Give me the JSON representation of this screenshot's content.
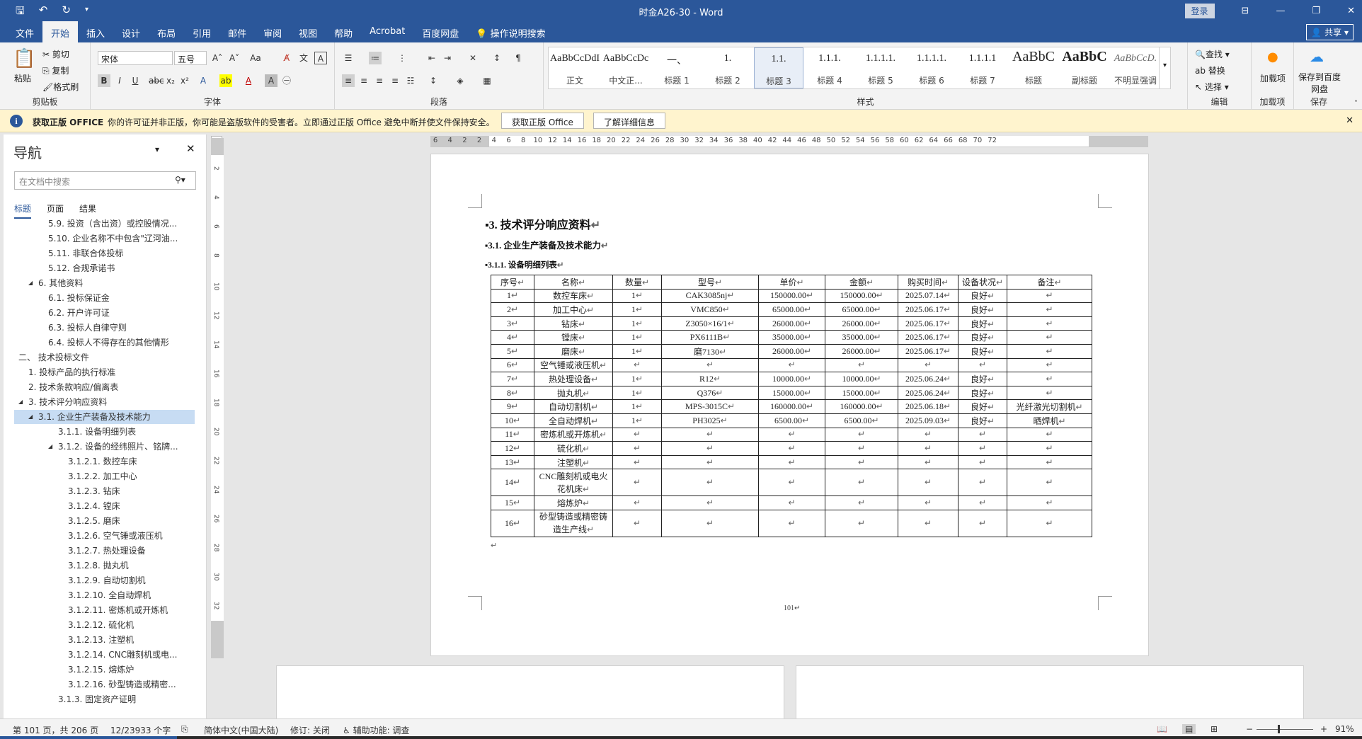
{
  "window": {
    "title": "时金A26-30  -  Word",
    "login": "登录",
    "share": "共享"
  },
  "tabs": [
    "文件",
    "开始",
    "插入",
    "设计",
    "布局",
    "引用",
    "邮件",
    "审阅",
    "视图",
    "帮助",
    "Acrobat",
    "百度网盘",
    "操作说明搜索"
  ],
  "ribbon": {
    "clipboard": {
      "paste": "粘贴",
      "cut": "剪切",
      "copy": "复制",
      "format_painter": "格式刷",
      "label": "剪贴板"
    },
    "font": {
      "name": "宋体",
      "size": "五号",
      "label": "字体"
    },
    "paragraph": {
      "label": "段落"
    },
    "styles": {
      "label": "样式",
      "items": [
        {
          "sample": "AaBbCcDdI",
          "name": "正文"
        },
        {
          "sample": "AaBbCcDc",
          "name": "中文正..."
        },
        {
          "sample": "一、",
          "name": "标题 1"
        },
        {
          "sample": "1.",
          "name": "标题 2"
        },
        {
          "sample": "1.1.",
          "name": "标题 3"
        },
        {
          "sample": "1.1.1.",
          "name": "标题 4"
        },
        {
          "sample": "1.1.1.1.",
          "name": "标题 5"
        },
        {
          "sample": "1.1.1.1.",
          "name": "标题 6"
        },
        {
          "sample": "1.1.1.1",
          "name": "标题 7"
        },
        {
          "sample": "AaBbC",
          "name": "标题"
        },
        {
          "sample": "AaBbC",
          "name": "副标题"
        },
        {
          "sample": "AaBbCcD.",
          "name": "不明显强调"
        }
      ]
    },
    "editing": {
      "find": "查找",
      "replace": "替换",
      "select": "选择",
      "label": "编辑"
    },
    "addins": {
      "btn": "加载项",
      "label": "加载项"
    },
    "save": {
      "btn": "保存到百度网盘",
      "label": "保存"
    }
  },
  "message_bar": {
    "title": "获取正版 OFFICE",
    "text": "你的许可证并非正版，你可能是盗版软件的受害者。立即通过正版 Office 避免中断并使文件保持安全。",
    "btn_get": "获取正版 Office",
    "btn_learn": "了解详细信息"
  },
  "nav": {
    "title": "导航",
    "search_placeholder": "在文档中搜索",
    "tabs": [
      "标题",
      "页面",
      "结果"
    ],
    "items": [
      {
        "text": "5.9. 投资（含出资）或控股情况...",
        "level": 4
      },
      {
        "text": "5.10. 企业名称不中包含\"辽河油...",
        "level": 4
      },
      {
        "text": "5.11. 非联合体投标",
        "level": 4
      },
      {
        "text": "5.12. 合规承诺书",
        "level": 4
      },
      {
        "text": "6. 其他资料",
        "level": 3,
        "arrow": "◢"
      },
      {
        "text": "6.1. 投标保证金",
        "level": 4
      },
      {
        "text": "6.2. 开户许可证",
        "level": 4
      },
      {
        "text": "6.3. 投标人自律守则",
        "level": 4
      },
      {
        "text": "6.4. 投标人不得存在的其他情形",
        "level": 4
      },
      {
        "text": "二、 技术投标文件",
        "level": 1,
        "arrow": "◢"
      },
      {
        "text": "1. 投标产品的执行标准",
        "level": 2
      },
      {
        "text": "2. 技术条款响应/偏离表",
        "level": 2
      },
      {
        "text": "3. 技术评分响应资料",
        "level": 2,
        "arrow": "◢"
      },
      {
        "text": "3.1. 企业生产装备及技术能力",
        "level": 3,
        "arrow": "◢",
        "selected": true
      },
      {
        "text": "3.1.1. 设备明细列表",
        "level": 5
      },
      {
        "text": "3.1.2. 设备的经纬照片、铭牌...",
        "level": 5,
        "arrow": "◢"
      },
      {
        "text": "3.1.2.1. 数控车床",
        "level": 6
      },
      {
        "text": "3.1.2.2. 加工中心",
        "level": 6
      },
      {
        "text": "3.1.2.3. 钻床",
        "level": 6
      },
      {
        "text": "3.1.2.4. 镗床",
        "level": 6
      },
      {
        "text": "3.1.2.5. 磨床",
        "level": 6
      },
      {
        "text": "3.1.2.6. 空气锤或液压机",
        "level": 6
      },
      {
        "text": "3.1.2.7. 热处理设备",
        "level": 6
      },
      {
        "text": "3.1.2.8. 抛丸机",
        "level": 6
      },
      {
        "text": "3.1.2.9. 自动切割机",
        "level": 6
      },
      {
        "text": "3.1.2.10. 全自动焊机",
        "level": 6
      },
      {
        "text": "3.1.2.11. 密炼机或开炼机",
        "level": 6
      },
      {
        "text": "3.1.2.12. 硫化机",
        "level": 6
      },
      {
        "text": "3.1.2.13. 注塑机",
        "level": 6
      },
      {
        "text": "3.1.2.14. CNC雕刻机或电...",
        "level": 6
      },
      {
        "text": "3.1.2.15. 熔炼炉",
        "level": 6
      },
      {
        "text": "3.1.2.16. 砂型铸造或精密...",
        "level": 6
      },
      {
        "text": "3.1.3. 固定资产证明",
        "level": 5
      }
    ]
  },
  "document": {
    "h1": "3. 技术评分响应资料",
    "h2": "3.1. 企业生产装备及技术能力",
    "h3": "3.1.1. 设备明细列表",
    "table": {
      "headers": [
        "序号",
        "名称",
        "数量",
        "型号",
        "单价",
        "金额",
        "购买时间",
        "设备状况",
        "备注"
      ],
      "rows": [
        [
          "1",
          "数控车床",
          "1",
          "CAK3085nj",
          "150000.00",
          "150000.00",
          "2025.07.14",
          "良好",
          ""
        ],
        [
          "2",
          "加工中心",
          "1",
          "VMC850",
          "65000.00",
          "65000.00",
          "2025.06.17",
          "良好",
          ""
        ],
        [
          "3",
          "钻床",
          "1",
          "Z3050×16/1",
          "26000.00",
          "26000.00",
          "2025.06.17",
          "良好",
          ""
        ],
        [
          "4",
          "镗床",
          "1",
          "PX6111B",
          "35000.00",
          "35000.00",
          "2025.06.17",
          "良好",
          ""
        ],
        [
          "5",
          "磨床",
          "1",
          "磨7130",
          "26000.00",
          "26000.00",
          "2025.06.17",
          "良好",
          ""
        ],
        [
          "6",
          "空气锤或液压机",
          "",
          "",
          "",
          "",
          "",
          "",
          ""
        ],
        [
          "7",
          "热处理设备",
          "1",
          "R12",
          "10000.00",
          "10000.00",
          "2025.06.24",
          "良好",
          ""
        ],
        [
          "8",
          "抛丸机",
          "1",
          "Q376",
          "15000.00",
          "15000.00",
          "2025.06.24",
          "良好",
          ""
        ],
        [
          "9",
          "自动切割机",
          "1",
          "MPS-3015C",
          "160000.00",
          "160000.00",
          "2025.06.18",
          "良好",
          "光纤激光切割机"
        ],
        [
          "10",
          "全自动焊机",
          "1",
          "PH3025",
          "6500.00",
          "6500.00",
          "2025.09.03",
          "良好",
          "晒焊机"
        ],
        [
          "11",
          "密炼机或开炼机",
          "",
          "",
          "",
          "",
          "",
          "",
          ""
        ],
        [
          "12",
          "硫化机",
          "",
          "",
          "",
          "",
          "",
          "",
          ""
        ],
        [
          "13",
          "注塑机",
          "",
          "",
          "",
          "",
          "",
          "",
          ""
        ],
        [
          "14",
          "CNC雕刻机或电火花机床",
          "",
          "",
          "",
          "",
          "",
          "",
          ""
        ],
        [
          "15",
          "熔炼炉",
          "",
          "",
          "",
          "",
          "",
          "",
          ""
        ],
        [
          "16",
          "砂型铸造或精密铸造生产线",
          "",
          "",
          "",
          "",
          "",
          "",
          ""
        ]
      ]
    },
    "page_number": "101"
  },
  "ruler": {
    "h_ticks": [
      "6",
      "4",
      "2",
      "2",
      "4",
      "6",
      "8",
      "10",
      "12",
      "14",
      "16",
      "18",
      "20",
      "22",
      "24",
      "26",
      "28",
      "30",
      "32",
      "34",
      "36",
      "38",
      "40",
      "42",
      "44",
      "46",
      "48",
      "50",
      "52",
      "54",
      "56",
      "58",
      "60",
      "62",
      "64",
      "66",
      "68",
      "70",
      "72"
    ],
    "v_ticks": [
      "2",
      "4",
      "6",
      "8",
      "10",
      "12",
      "14",
      "16",
      "18",
      "20",
      "22",
      "24",
      "26",
      "28",
      "30",
      "32"
    ]
  },
  "status": {
    "page": "第 101 页，共 206 页",
    "words": "12/23933 个字",
    "lang": "简体中文(中国大陆)",
    "track": "修订: 关闭",
    "access": "辅助功能: 调查",
    "zoom": "91%"
  }
}
